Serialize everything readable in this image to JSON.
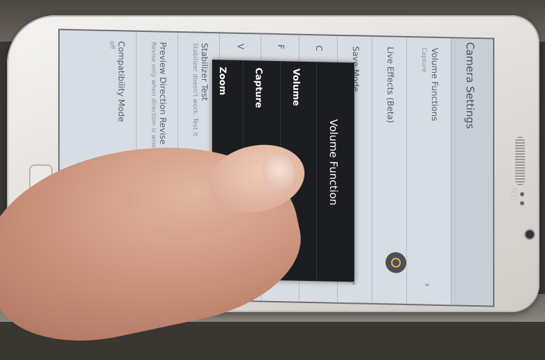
{
  "phone": {
    "brand": "NG"
  },
  "header": {
    "title": "Camera Settings"
  },
  "settings": {
    "rows": [
      {
        "title": "Volume Functions",
        "subtitle": "Capture"
      },
      {
        "title": "Live Effects (Beta)",
        "subtitle": ""
      },
      {
        "title": "Save Mode",
        "subtitle": ""
      },
      {
        "title": "C",
        "subtitle": ""
      },
      {
        "title": "F",
        "subtitle": ""
      },
      {
        "title": "V",
        "subtitle": ""
      },
      {
        "title": "Stabilizer Test",
        "subtitle": "Stabilizer doesn't work. Test it"
      },
      {
        "title": "Preview Direction Revise",
        "subtitle": "Revise only when direction is wrong"
      },
      {
        "title": "Compatibility Mode",
        "subtitle": "off"
      }
    ]
  },
  "dialog": {
    "title": "Volume Function",
    "options": [
      "Volume",
      "Capture",
      "Zoom"
    ],
    "selected": "Capture"
  },
  "colors": {
    "dialog_bg": "#1c1d20",
    "screen_bg": "#d7dde4",
    "toggle_accent": "#e6b54a"
  }
}
